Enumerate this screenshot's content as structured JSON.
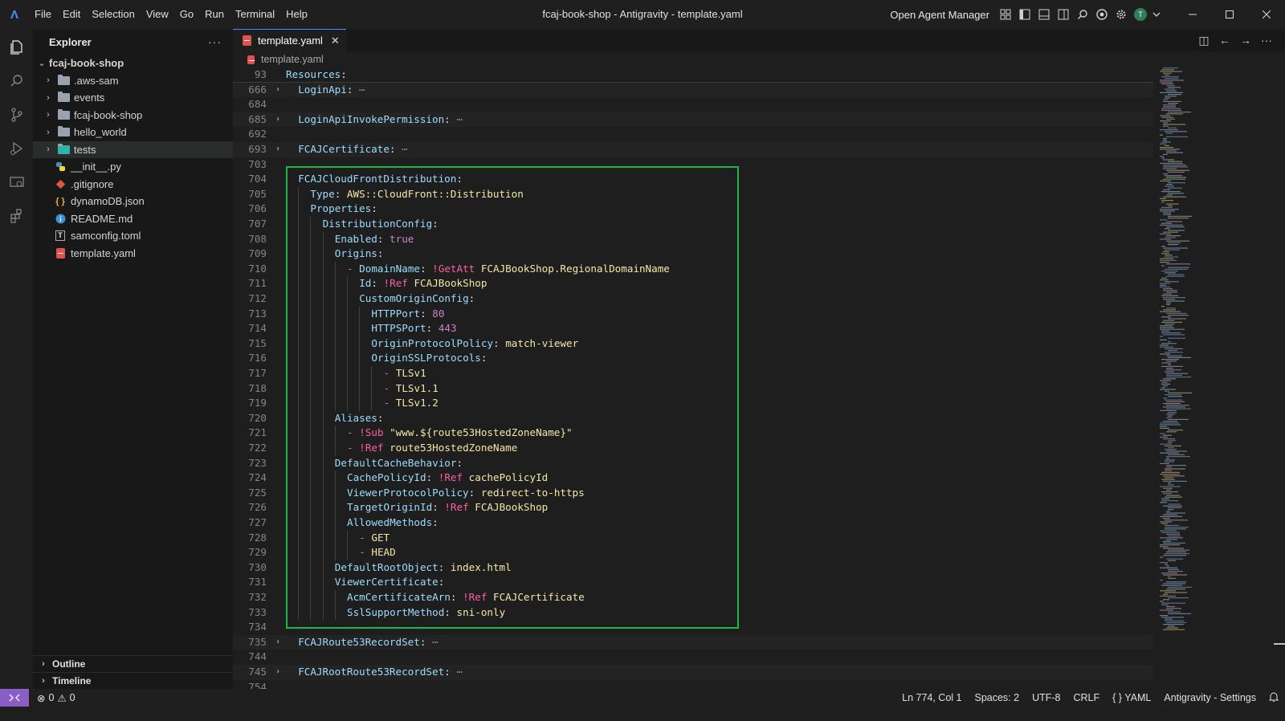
{
  "app": {
    "window_title": "fcaj-book-shop - Antigravity - template.yaml",
    "menu": [
      "File",
      "Edit",
      "Selection",
      "View",
      "Go",
      "Run",
      "Terminal",
      "Help"
    ],
    "agent_manager": "Open Agent Manager",
    "avatar_letter": "T"
  },
  "activity_bar": [
    "explorer-icon",
    "search-icon",
    "source-control-icon",
    "run-debug-icon",
    "remote-explorer-icon",
    "extensions-icon"
  ],
  "sidebar": {
    "title": "Explorer",
    "root": "fcaj-book-shop",
    "items": [
      {
        "label": ".aws-sam",
        "kind": "folder",
        "icon": "folder-icon"
      },
      {
        "label": "events",
        "kind": "folder",
        "icon": "folder-icon"
      },
      {
        "label": "fcaj-book-shop",
        "kind": "folder",
        "icon": "folder-icon"
      },
      {
        "label": "hello_world",
        "kind": "folder",
        "icon": "folder-icon"
      },
      {
        "label": "tests",
        "kind": "folder",
        "icon": "test-folder-icon"
      },
      {
        "label": "__init__.py",
        "kind": "file",
        "icon": "python-icon"
      },
      {
        "label": ".gitignore",
        "kind": "file",
        "icon": "git-icon"
      },
      {
        "label": "dynamoDB.json",
        "kind": "file",
        "icon": "json-icon"
      },
      {
        "label": "README.md",
        "kind": "file",
        "icon": "info-icon"
      },
      {
        "label": "samconfig.toml",
        "kind": "file",
        "icon": "toml-icon"
      },
      {
        "label": "template.yaml",
        "kind": "file",
        "icon": "yaml-icon"
      }
    ],
    "panels": [
      "Outline",
      "Timeline"
    ]
  },
  "editor": {
    "tab_label": "template.yaml",
    "breadcrumb": "template.yaml",
    "lines": [
      {
        "n": "93",
        "indent": 0,
        "fold": "",
        "tokens": [
          [
            "k",
            "Resources"
          ],
          [
            "p",
            ":"
          ]
        ],
        "sticky": true
      },
      {
        "n": "666",
        "indent": 1,
        "fold": "›",
        "tokens": [
          [
            "k",
            "LoginApi"
          ],
          [
            "p",
            ":"
          ],
          [
            "ell",
            " ⋯"
          ]
        ],
        "folded": true
      },
      {
        "n": "684",
        "indent": 0,
        "fold": "",
        "tokens": []
      },
      {
        "n": "685",
        "indent": 1,
        "fold": "›",
        "tokens": [
          [
            "k",
            "LoginApiInvokePermission"
          ],
          [
            "p",
            ":"
          ],
          [
            "ell",
            " ⋯"
          ]
        ],
        "folded": true
      },
      {
        "n": "692",
        "indent": 0,
        "fold": "",
        "tokens": []
      },
      {
        "n": "693",
        "indent": 1,
        "fold": "›",
        "tokens": [
          [
            "k",
            "FCAJCertificate"
          ],
          [
            "p",
            ":"
          ],
          [
            "ell",
            " ⋯"
          ]
        ],
        "folded": true
      },
      {
        "n": "703",
        "indent": 0,
        "fold": "",
        "tokens": []
      },
      {
        "n": "704",
        "indent": 1,
        "fold": "",
        "tokens": [
          [
            "k",
            "FCAJCloudFrontDistribution"
          ],
          [
            "p",
            ":"
          ]
        ]
      },
      {
        "n": "705",
        "indent": 2,
        "fold": "",
        "tokens": [
          [
            "k",
            "Type"
          ],
          [
            "p",
            ": "
          ],
          [
            "s",
            "AWS::CloudFront::Distribution"
          ]
        ]
      },
      {
        "n": "706",
        "indent": 2,
        "fold": "",
        "tokens": [
          [
            "k",
            "Properties"
          ],
          [
            "p",
            ":"
          ]
        ]
      },
      {
        "n": "707",
        "indent": 3,
        "fold": "",
        "tokens": [
          [
            "k",
            "DistributionConfig"
          ],
          [
            "p",
            ":"
          ]
        ]
      },
      {
        "n": "708",
        "indent": 4,
        "fold": "",
        "tokens": [
          [
            "k",
            "Enabled"
          ],
          [
            "p",
            ": "
          ],
          [
            "b",
            "true"
          ]
        ]
      },
      {
        "n": "709",
        "indent": 4,
        "fold": "",
        "tokens": [
          [
            "k",
            "Origins"
          ],
          [
            "p",
            ":"
          ]
        ]
      },
      {
        "n": "710",
        "indent": 5,
        "fold": "",
        "tokens": [
          [
            "dash",
            "- "
          ],
          [
            "k",
            "DomainName"
          ],
          [
            "p",
            ": "
          ],
          [
            "t",
            "!GetAtt "
          ],
          [
            "s",
            "FCAJBookShop.RegionalDomainName"
          ]
        ]
      },
      {
        "n": "711",
        "indent": 6,
        "fold": "",
        "tokens": [
          [
            "k",
            "Id"
          ],
          [
            "p",
            ": "
          ],
          [
            "t",
            "!Ref "
          ],
          [
            "s",
            "FCAJBookShop"
          ]
        ]
      },
      {
        "n": "712",
        "indent": 6,
        "fold": "",
        "tokens": [
          [
            "k",
            "CustomOriginConfig"
          ],
          [
            "p",
            ":"
          ]
        ]
      },
      {
        "n": "713",
        "indent": 7,
        "fold": "",
        "tokens": [
          [
            "k",
            "HTTPPort"
          ],
          [
            "p",
            ": "
          ],
          [
            "n",
            "80"
          ]
        ]
      },
      {
        "n": "714",
        "indent": 7,
        "fold": "",
        "tokens": [
          [
            "k",
            "HTTPSPort"
          ],
          [
            "p",
            ": "
          ],
          [
            "n",
            "443"
          ]
        ]
      },
      {
        "n": "715",
        "indent": 7,
        "fold": "",
        "tokens": [
          [
            "k",
            "OriginProtocolPolicy"
          ],
          [
            "p",
            ": "
          ],
          [
            "s",
            "match-viewer"
          ]
        ]
      },
      {
        "n": "716",
        "indent": 7,
        "fold": "",
        "tokens": [
          [
            "k",
            "OriginSSLProtocols"
          ],
          [
            "p",
            ":"
          ]
        ]
      },
      {
        "n": "717",
        "indent": 8,
        "fold": "",
        "tokens": [
          [
            "dash",
            "- "
          ],
          [
            "s",
            "TLSv1"
          ]
        ]
      },
      {
        "n": "718",
        "indent": 8,
        "fold": "",
        "tokens": [
          [
            "dash",
            "- "
          ],
          [
            "s",
            "TLSv1.1"
          ]
        ]
      },
      {
        "n": "719",
        "indent": 8,
        "fold": "",
        "tokens": [
          [
            "dash",
            "- "
          ],
          [
            "s",
            "TLSv1.2"
          ]
        ]
      },
      {
        "n": "720",
        "indent": 4,
        "fold": "",
        "tokens": [
          [
            "k",
            "Aliases"
          ],
          [
            "p",
            ":"
          ]
        ]
      },
      {
        "n": "721",
        "indent": 5,
        "fold": "",
        "tokens": [
          [
            "dash",
            "- "
          ],
          [
            "t",
            "!Sub "
          ],
          [
            "s",
            "\"www.${route53HostedZoneName}\""
          ]
        ]
      },
      {
        "n": "722",
        "indent": 5,
        "fold": "",
        "tokens": [
          [
            "dash",
            "- "
          ],
          [
            "t",
            "!Ref "
          ],
          [
            "s",
            "route53HostedZoneName"
          ]
        ]
      },
      {
        "n": "723",
        "indent": 4,
        "fold": "",
        "tokens": [
          [
            "k",
            "DefaultCacheBehavior"
          ],
          [
            "p",
            ":"
          ]
        ]
      },
      {
        "n": "724",
        "indent": 5,
        "fold": "",
        "tokens": [
          [
            "k",
            "CachePolicyId"
          ],
          [
            "p",
            ": "
          ],
          [
            "t",
            "!Ref "
          ],
          [
            "s",
            "cachePolicyId"
          ]
        ]
      },
      {
        "n": "725",
        "indent": 5,
        "fold": "",
        "tokens": [
          [
            "k",
            "ViewerProtocolPolicy"
          ],
          [
            "p",
            ": "
          ],
          [
            "s",
            "redirect-to-https"
          ]
        ]
      },
      {
        "n": "726",
        "indent": 5,
        "fold": "",
        "tokens": [
          [
            "k",
            "TargetOriginId"
          ],
          [
            "p",
            ": "
          ],
          [
            "t",
            "!Ref "
          ],
          [
            "s",
            "FCAJBookShop"
          ]
        ]
      },
      {
        "n": "727",
        "indent": 5,
        "fold": "",
        "tokens": [
          [
            "k",
            "AllowedMethods"
          ],
          [
            "p",
            ":"
          ]
        ]
      },
      {
        "n": "728",
        "indent": 6,
        "fold": "",
        "tokens": [
          [
            "dash",
            "- "
          ],
          [
            "s",
            "GET"
          ]
        ]
      },
      {
        "n": "729",
        "indent": 6,
        "fold": "",
        "tokens": [
          [
            "dash",
            "- "
          ],
          [
            "s",
            "HEAD"
          ]
        ]
      },
      {
        "n": "730",
        "indent": 4,
        "fold": "",
        "tokens": [
          [
            "k",
            "DefaultRootObject"
          ],
          [
            "p",
            ": "
          ],
          [
            "s",
            "index.html"
          ]
        ]
      },
      {
        "n": "731",
        "indent": 4,
        "fold": "",
        "tokens": [
          [
            "k",
            "ViewerCertificate"
          ],
          [
            "p",
            ":"
          ]
        ]
      },
      {
        "n": "732",
        "indent": 5,
        "fold": "",
        "tokens": [
          [
            "k",
            "AcmCertificateArn"
          ],
          [
            "p",
            ": "
          ],
          [
            "t",
            "!Ref "
          ],
          [
            "s",
            "FCAJCertificate"
          ]
        ]
      },
      {
        "n": "733",
        "indent": 5,
        "fold": "",
        "tokens": [
          [
            "k",
            "SslSupportMethod"
          ],
          [
            "p",
            ": "
          ],
          [
            "s",
            "sni-only"
          ]
        ]
      },
      {
        "n": "734",
        "indent": 0,
        "fold": "",
        "tokens": []
      },
      {
        "n": "735",
        "indent": 1,
        "fold": "›",
        "tokens": [
          [
            "k",
            "FCAJRoute53RecordSet"
          ],
          [
            "p",
            ":"
          ],
          [
            "ell",
            " ⋯"
          ]
        ],
        "folded": true
      },
      {
        "n": "744",
        "indent": 0,
        "fold": "",
        "tokens": []
      },
      {
        "n": "745",
        "indent": 1,
        "fold": "›",
        "tokens": [
          [
            "k",
            "FCAJRootRoute53RecordSet"
          ],
          [
            "p",
            ":"
          ],
          [
            "ell",
            " ⋯"
          ]
        ],
        "folded": true
      },
      {
        "n": "754",
        "indent": 0,
        "fold": "",
        "tokens": []
      }
    ]
  },
  "statusbar": {
    "errors": "0",
    "warnings": "0",
    "position": "Ln 774, Col 1",
    "spaces": "Spaces: 2",
    "encoding": "UTF-8",
    "eol": "CRLF",
    "language": "YAML",
    "settings": "Antigravity - Settings"
  },
  "colors": {
    "accent": "#4a8cff",
    "highlight_box": "#1fb549",
    "remote_button": "#8c5cc7"
  }
}
